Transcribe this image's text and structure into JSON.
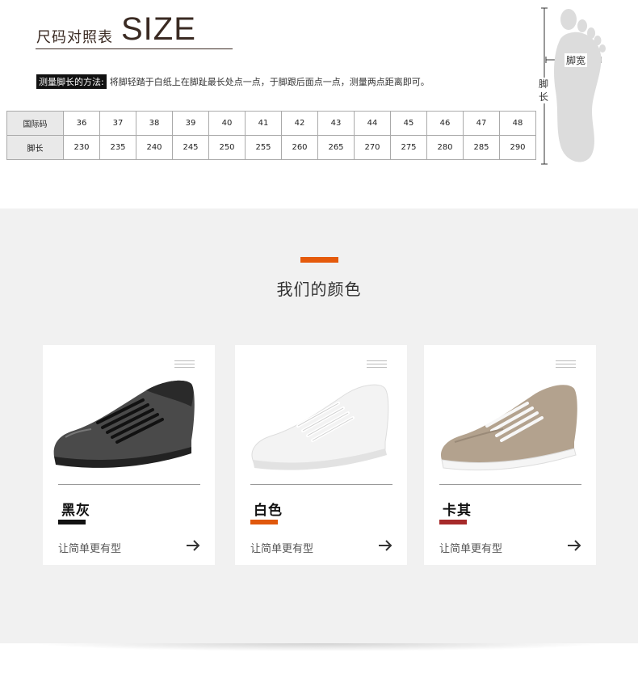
{
  "size_section": {
    "title_cn": "尺码对照表",
    "title_en": "SIZE",
    "method_label": "测量脚长的方法:",
    "method_text": "将脚轻踏于白纸上在脚趾最长处点一点，于脚跟后面点一点，测量两点距离即可。",
    "table": {
      "row1_label": "国际码",
      "row2_label": "脚长",
      "sizes": [
        "36",
        "37",
        "38",
        "39",
        "40",
        "41",
        "42",
        "43",
        "44",
        "45",
        "46",
        "47",
        "48"
      ],
      "lengths": [
        "230",
        "235",
        "240",
        "245",
        "250",
        "255",
        "260",
        "265",
        "270",
        "275",
        "280",
        "285",
        "290"
      ]
    },
    "foot_width_label": "脚宽",
    "foot_length_label": [
      "脚",
      "长"
    ]
  },
  "colors_section": {
    "title": "我们的颜色",
    "accent_color": "#e55a0c",
    "cards": [
      {
        "name": "黑灰",
        "tagline": "让简单更有型",
        "swatch_color": "#111111",
        "shoe_color": "black-grey"
      },
      {
        "name": "白色",
        "tagline": "让简单更有型",
        "swatch_color": "#e0580c",
        "shoe_color": "white"
      },
      {
        "name": "卡其",
        "tagline": "让简单更有型",
        "swatch_color": "#a62a2a",
        "shoe_color": "khaki"
      }
    ]
  }
}
